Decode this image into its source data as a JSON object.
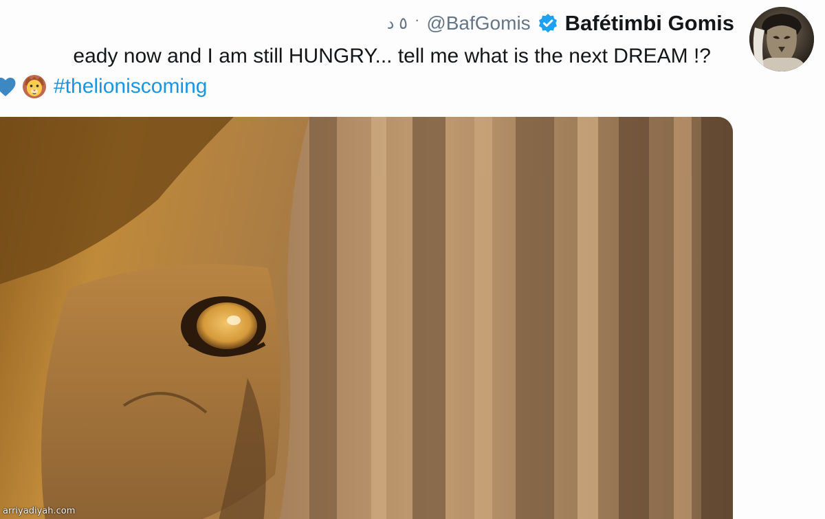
{
  "tweet": {
    "display_name": "Bafétimbi Gomis",
    "handle": "@BafGomis",
    "separator": "·",
    "time": "٥ د",
    "verified": true,
    "text_line1": "eady now and I am still HUNGRY... tell me what is the next DREAM !?",
    "hashtag": "#thelioniscoming",
    "emojis": [
      "blue-heart-emoji",
      "lion-face-emoji"
    ],
    "media": {
      "subject": "lion-eye-photo"
    }
  },
  "watermark": {
    "text": "arriyadiyah.com"
  },
  "colors": {
    "link": "#1b95e0",
    "secondary_text": "#657786",
    "verified_badge": "#1da1f2"
  }
}
